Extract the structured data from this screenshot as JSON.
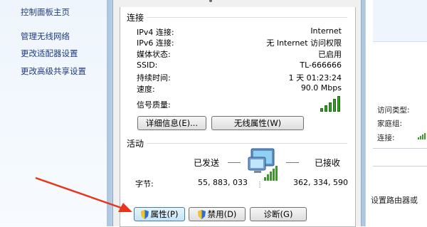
{
  "sidebar": {
    "home": "控制面板主页",
    "items": [
      "管理无线网络",
      "更改适配器设置",
      "更改高级共享设置"
    ]
  },
  "dialog": {
    "connection": {
      "title": "连接",
      "rows": [
        {
          "label": "IPv4 连接:",
          "value": "Internet"
        },
        {
          "label": "IPv6 连接:",
          "value": "无 Internet 访问权限"
        },
        {
          "label": "媒体状态:",
          "value": "已启用"
        },
        {
          "label": "SSID:",
          "value": "TL-666666"
        },
        {
          "label": "持续时间:",
          "value": "1 天 01:23:24"
        },
        {
          "label": "速度:",
          "value": "90.0 Mbps"
        }
      ],
      "signal_label": "信号质量:",
      "signal_bars": 5,
      "details_button": "详细信息(E)...",
      "wireless_button": "无线属性(W)"
    },
    "activity": {
      "title": "活动",
      "sent_label": "已发送",
      "received_label": "已接收",
      "bytes_label": "字节:",
      "sent_bytes": "55, 883, 033",
      "received_bytes": "362, 334, 590"
    },
    "buttons": {
      "properties": "属性(P)",
      "disable": "禁用(D)",
      "diagnose": "诊断(G)"
    }
  },
  "background_window": {
    "access_type": "访问类型:",
    "homegroup": "家庭组:",
    "connection": "连接:",
    "bottom_text": "设置路由器或"
  },
  "colors": {
    "link": "#1f3b80",
    "accent_arrow": "#e8361c",
    "signal_green": "#3a9a2a"
  }
}
